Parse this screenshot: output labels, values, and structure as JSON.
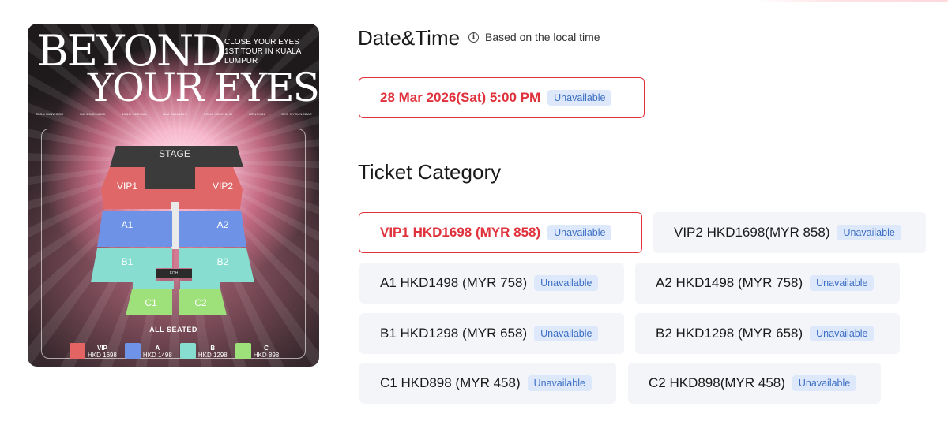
{
  "poster": {
    "title_line1": "BEYOND",
    "title_line2": "YOUR EYES",
    "subtitle": "CLOSE YOUR EYES 1ST TOUR IN KUALA LUMPUR",
    "members": [
      "JEON MINWOOK",
      "MA JINGXIANG",
      "JANG YEOJUN",
      "KIM SUNGMIN",
      "SONG SEUNGHO",
      "KENSHIN",
      "SEO KYOUNGBAE"
    ],
    "seatmap": {
      "stage": "STAGE",
      "zones": [
        "VIP1",
        "VIP2",
        "A1",
        "A2",
        "B1",
        "B2",
        "C1",
        "C2"
      ],
      "foh": "FOH",
      "note": "ALL SEATED"
    },
    "legend": [
      {
        "name": "VIP",
        "price": "HKD 1698",
        "color": "#e46464"
      },
      {
        "name": "A",
        "price": "HKD 1498",
        "color": "#6f93e6"
      },
      {
        "name": "B",
        "price": "HKD 1298",
        "color": "#86ddd0"
      },
      {
        "name": "C",
        "price": "HKD 898",
        "color": "#9ee07a"
      }
    ]
  },
  "datetime": {
    "title": "Date&Time",
    "info": "Based on the local time",
    "option": {
      "label": "28 Mar 2026(Sat) 5:00 PM",
      "status": "Unavailable"
    }
  },
  "tickets": {
    "title": "Ticket Category",
    "items": [
      {
        "label": "VIP1 HKD1698 (MYR 858)",
        "status": "Unavailable"
      },
      {
        "label": "VIP2 HKD1698(MYR 858)",
        "status": "Unavailable"
      },
      {
        "label": "A1 HKD1498 (MYR 758)",
        "status": "Unavailable"
      },
      {
        "label": "A2 HKD1498 (MYR 758)",
        "status": "Unavailable"
      },
      {
        "label": "B1 HKD1298 (MYR 658)",
        "status": "Unavailable"
      },
      {
        "label": "B2 HKD1298 (MYR 658)",
        "status": "Unavailable"
      },
      {
        "label": "C1 HKD898 (MYR 458)",
        "status": "Unavailable"
      },
      {
        "label": "C2 HKD898(MYR 458)",
        "status": "Unavailable"
      }
    ]
  },
  "colors": {
    "accent": "#e0323c",
    "badge_text": "#3d6fc4",
    "badge_bg": "#dde8fa",
    "card_bg": "#f4f5f9"
  }
}
